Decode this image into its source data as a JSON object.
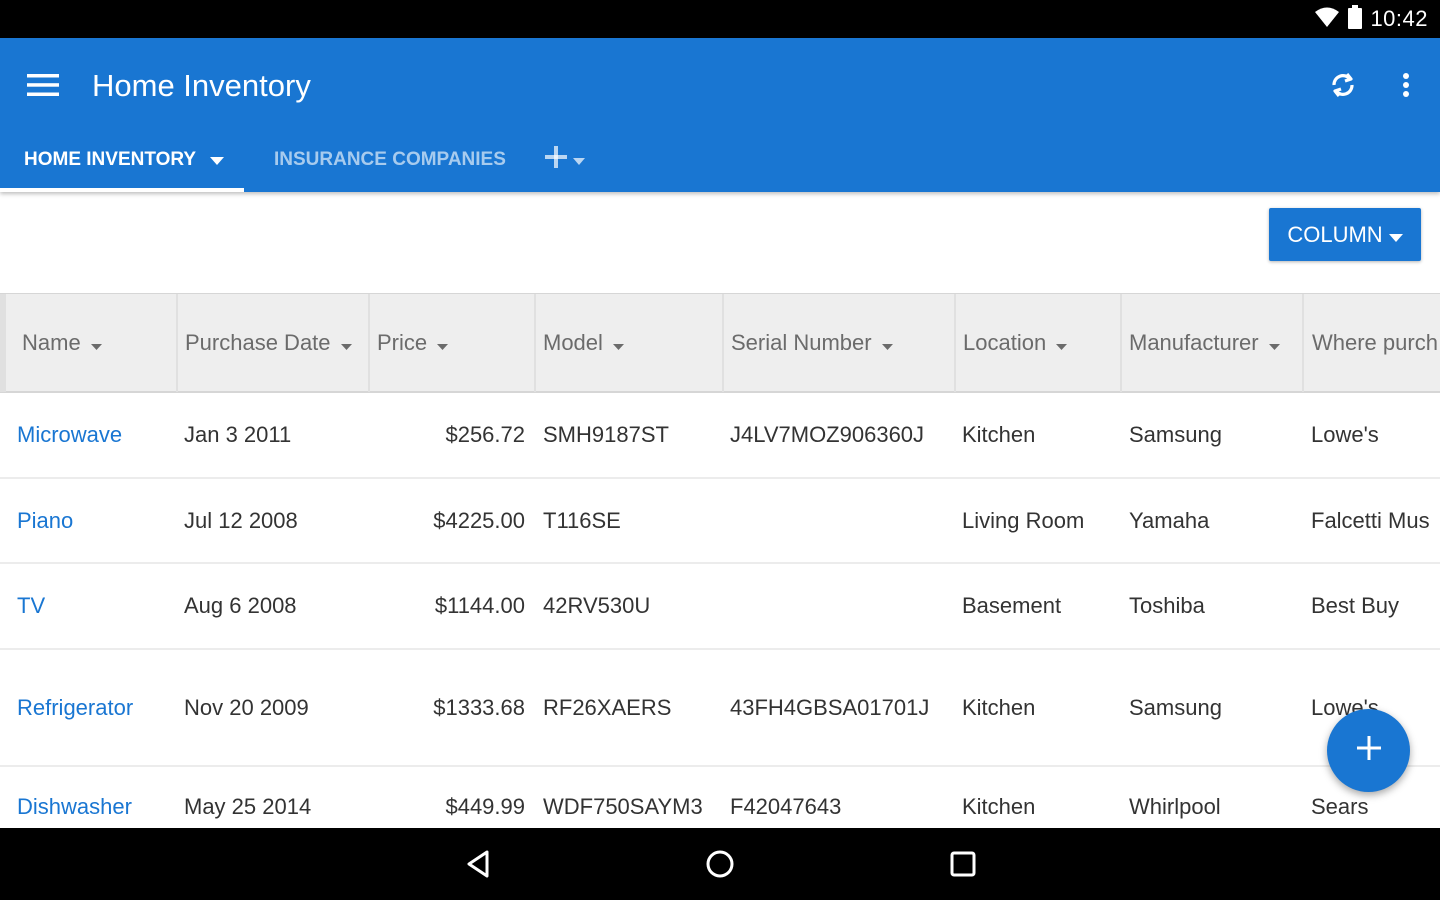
{
  "status_bar": {
    "time": "10:42",
    "icons": [
      "wifi-icon",
      "battery-icon"
    ]
  },
  "app_bar": {
    "title": "Home Inventory",
    "color": "#1976D2",
    "icons": [
      "menu-icon",
      "sync-icon",
      "more-vert-icon"
    ]
  },
  "tabs": [
    {
      "label": "HOME INVENTORY",
      "active": true
    },
    {
      "label": "INSURANCE COMPANIES",
      "active": false
    }
  ],
  "add_tab_icon": "plus-icon",
  "toolbar": {
    "column_label": "COLUMN"
  },
  "table": {
    "columns": [
      "Name",
      "Purchase Date",
      "Price",
      "Model",
      "Serial Number",
      "Location",
      "Manufacturer",
      "Where purch"
    ],
    "rows": [
      {
        "name": "Microwave",
        "purchase_date": "Jan 3 2011",
        "price": "$256.72",
        "model": "SMH9187ST",
        "serial": "J4LV7MOZ906360J",
        "location": "Kitchen",
        "manufacturer": "Samsung",
        "where": "Lowe's"
      },
      {
        "name": "Piano",
        "purchase_date": "Jul 12 2008",
        "price": "$4225.00",
        "model": "T116SE",
        "serial": "",
        "location": "Living Room",
        "manufacturer": "Yamaha",
        "where": "Falcetti Mus"
      },
      {
        "name": "TV",
        "purchase_date": "Aug 6 2008",
        "price": "$1144.00",
        "model": "42RV530U",
        "serial": "",
        "location": "Basement",
        "manufacturer": "Toshiba",
        "where": "Best Buy"
      },
      {
        "name": "Refrigerator",
        "purchase_date": "Nov 20 2009",
        "price": "$1333.68",
        "model": "RF26XAERS",
        "serial": "43FH4GBSA01701J",
        "location": "Kitchen",
        "manufacturer": "Samsung",
        "where": "Lowe's"
      },
      {
        "name": "Dishwasher",
        "purchase_date": "May 25 2014",
        "price": "$449.99",
        "model": "WDF750SAYM3",
        "serial": "F42047643",
        "location": "Kitchen",
        "manufacturer": "Whirlpool",
        "where": "Sears"
      }
    ]
  },
  "fab": {
    "icon": "plus-icon"
  },
  "nav_bar": {
    "icons": [
      "back-icon",
      "home-icon",
      "recents-icon"
    ]
  }
}
